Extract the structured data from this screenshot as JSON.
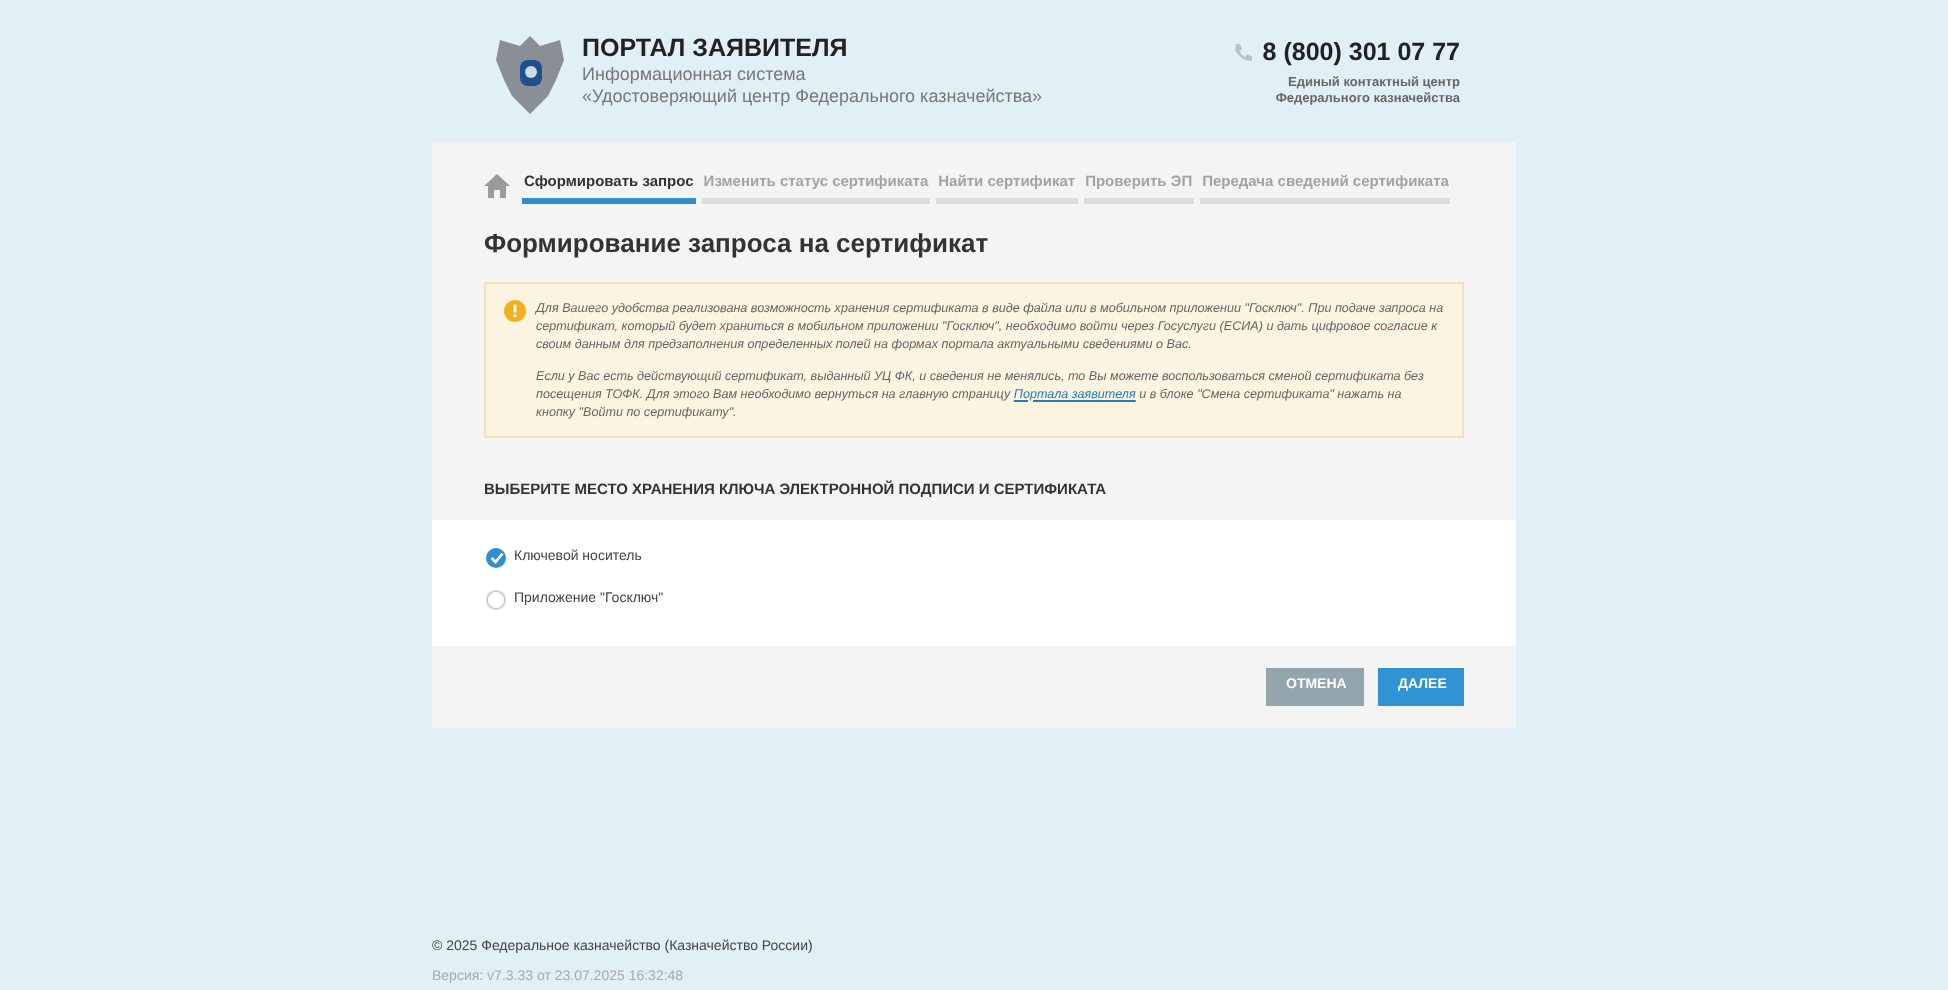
{
  "header": {
    "title": "ПОРТАЛ ЗАЯВИТЕЛЯ",
    "subtitle_1": "Информационная система",
    "subtitle_2": "«Удостоверяющий центр Федерального казначейства»",
    "phone": "8 (800) 301 07 77",
    "phone_caption_1": "Единый контактный центр",
    "phone_caption_2": "Федерального казначейства"
  },
  "tabs": [
    {
      "label": "Сформировать запрос",
      "selected": true
    },
    {
      "label": "Изменить статус сертификата",
      "selected": false
    },
    {
      "label": "Найти сертификат",
      "selected": false
    },
    {
      "label": "Проверить ЭП",
      "selected": false
    },
    {
      "label": "Передача сведений сертификата",
      "selected": false
    }
  ],
  "page_title": "Формирование запроса на сертификат",
  "notice": {
    "paragraph_1": "Для Вашего удобства реализована возможность хранения сертификата в виде файла или в мобильном приложении \"Госключ\". При подаче запроса на сертификат, который будет храниться в мобильном приложении \"Госключ\", необходимо войти через Госуслуги (ЕСИА) и дать цифровое согласие к своим данным для предзаполнения определенных полей на формах портала актуальными сведениями о Вас.",
    "paragraph_2_before": "Если у Вас есть действующий сертификат, выданный УЦ ФК, и сведения не менялись, то Вы можете воспользоваться сменой сертификата без посещения ТОФК. Для этого Вам необходимо вернуться на главную страницу",
    "paragraph_2_link": "Портала заявителя",
    "paragraph_2_after": "и в блоке \"Смена сертификата\" нажать на кнопку \"Войти по сертификату\"."
  },
  "section_title": "ВЫБЕРИТЕ МЕСТО ХРАНЕНИЯ КЛЮЧА ЭЛЕКТРОННОЙ ПОДПИСИ И СЕРТИФИКАТА",
  "options": [
    {
      "label": "Ключевой носитель",
      "selected": true
    },
    {
      "label": "Приложение \"Госключ\"",
      "selected": false
    }
  ],
  "buttons": [
    {
      "label": "ОТМЕНА",
      "kind": "secondary"
    },
    {
      "label": "ДАЛЕЕ",
      "kind": "primary"
    }
  ],
  "footer": {
    "copyright": "© 2025 Федеральное казначейство (Казначейство России)",
    "version": "Версия: v7.3.33 от 23.07.2025 16:32:48"
  }
}
